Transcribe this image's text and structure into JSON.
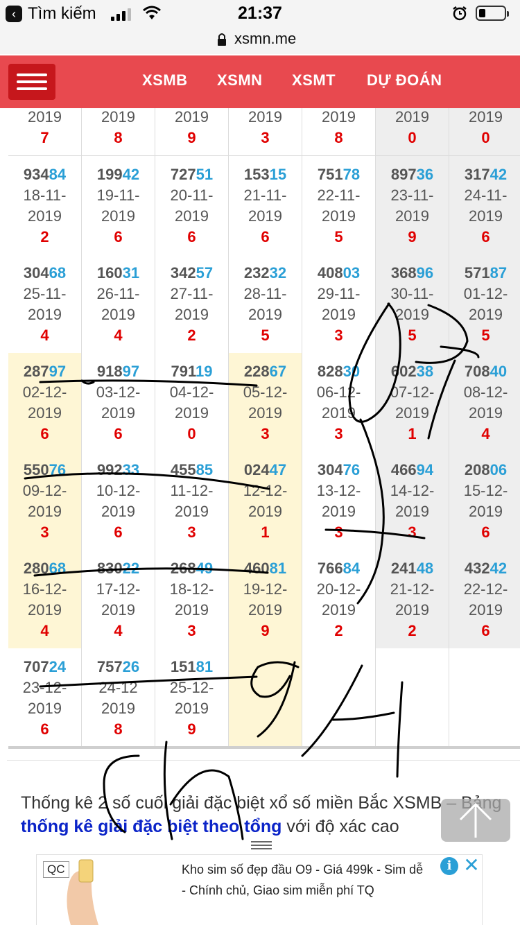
{
  "status_bar": {
    "back_label": "Tìm kiếm",
    "time": "21:37",
    "url": "xsmn.me"
  },
  "nav": {
    "items": [
      "XSMB",
      "XSMN",
      "XSMT",
      "DỰ ĐOÁN"
    ]
  },
  "table": {
    "top_partial_row": {
      "years": [
        "2019",
        "2019",
        "2019",
        "2019",
        "2019",
        "2019",
        "2019"
      ],
      "totals": [
        "7",
        "8",
        "9",
        "3",
        "8",
        "0",
        "0"
      ]
    },
    "rows": [
      [
        {
          "head": "934",
          "tail": "84",
          "date": "18-11-",
          "year": "2019",
          "total": "2"
        },
        {
          "head": "199",
          "tail": "42",
          "date": "19-11-",
          "year": "2019",
          "total": "6"
        },
        {
          "head": "727",
          "tail": "51",
          "date": "20-11-",
          "year": "2019",
          "total": "6"
        },
        {
          "head": "153",
          "tail": "15",
          "date": "21-11-",
          "year": "2019",
          "total": "6"
        },
        {
          "head": "751",
          "tail": "78",
          "date": "22-11-",
          "year": "2019",
          "total": "5"
        },
        {
          "head": "897",
          "tail": "36",
          "date": "23-11-",
          "year": "2019",
          "total": "9"
        },
        {
          "head": "317",
          "tail": "42",
          "date": "24-11-",
          "year": "2019",
          "total": "6"
        }
      ],
      [
        {
          "head": "304",
          "tail": "68",
          "date": "25-11-",
          "year": "2019",
          "total": "4"
        },
        {
          "head": "160",
          "tail": "31",
          "date": "26-11-",
          "year": "2019",
          "total": "4"
        },
        {
          "head": "342",
          "tail": "57",
          "date": "27-11-",
          "year": "2019",
          "total": "2"
        },
        {
          "head": "232",
          "tail": "32",
          "date": "28-11-",
          "year": "2019",
          "total": "5"
        },
        {
          "head": "408",
          "tail": "03",
          "date": "29-11-",
          "year": "2019",
          "total": "3"
        },
        {
          "head": "368",
          "tail": "96",
          "date": "30-11-",
          "year": "2019",
          "total": "5"
        },
        {
          "head": "571",
          "tail": "87",
          "date": "01-12-",
          "year": "2019",
          "total": "5"
        }
      ],
      [
        {
          "head": "287",
          "tail": "97",
          "date": "02-12-",
          "year": "2019",
          "total": "6"
        },
        {
          "head": "918",
          "tail": "97",
          "date": "03-12-",
          "year": "2019",
          "total": "6"
        },
        {
          "head": "791",
          "tail": "19",
          "date": "04-12-",
          "year": "2019",
          "total": "0"
        },
        {
          "head": "228",
          "tail": "67",
          "date": "05-12-",
          "year": "2019",
          "total": "3"
        },
        {
          "head": "828",
          "tail": "30",
          "date": "06-12-",
          "year": "2019",
          "total": "3"
        },
        {
          "head": "602",
          "tail": "38",
          "date": "07-12-",
          "year": "2019",
          "total": "1"
        },
        {
          "head": "708",
          "tail": "40",
          "date": "08-12-",
          "year": "2019",
          "total": "4"
        }
      ],
      [
        {
          "head": "550",
          "tail": "76",
          "date": "09-12-",
          "year": "2019",
          "total": "3"
        },
        {
          "head": "992",
          "tail": "33",
          "date": "10-12-",
          "year": "2019",
          "total": "6"
        },
        {
          "head": "455",
          "tail": "85",
          "date": "11-12-",
          "year": "2019",
          "total": "3"
        },
        {
          "head": "024",
          "tail": "47",
          "date": "12-12-",
          "year": "2019",
          "total": "1"
        },
        {
          "head": "304",
          "tail": "76",
          "date": "13-12-",
          "year": "2019",
          "total": "3"
        },
        {
          "head": "466",
          "tail": "94",
          "date": "14-12-",
          "year": "2019",
          "total": "3"
        },
        {
          "head": "208",
          "tail": "06",
          "date": "15-12-",
          "year": "2019",
          "total": "6"
        }
      ],
      [
        {
          "head": "280",
          "tail": "68",
          "date": "16-12-",
          "year": "2019",
          "total": "4"
        },
        {
          "head": "830",
          "tail": "22",
          "date": "17-12-",
          "year": "2019",
          "total": "4"
        },
        {
          "head": "268",
          "tail": "49",
          "date": "18-12-",
          "year": "2019",
          "total": "3"
        },
        {
          "head": "460",
          "tail": "81",
          "date": "19-12-",
          "year": "2019",
          "total": "9"
        },
        {
          "head": "766",
          "tail": "84",
          "date": "20-12-",
          "year": "2019",
          "total": "2"
        },
        {
          "head": "241",
          "tail": "48",
          "date": "21-12-",
          "year": "2019",
          "total": "2"
        },
        {
          "head": "432",
          "tail": "42",
          "date": "22-12-",
          "year": "2019",
          "total": "6"
        }
      ],
      [
        {
          "head": "707",
          "tail": "24",
          "date": "23-12-",
          "year": "2019",
          "total": "6"
        },
        {
          "head": "757",
          "tail": "26",
          "date": "24-12",
          "year": "2019",
          "total": "8"
        },
        {
          "head": "151",
          "tail": "81",
          "date": "25-12-",
          "year": "2019",
          "total": "9"
        },
        {
          "head": "",
          "tail": "",
          "date": "",
          "year": "",
          "total": ""
        },
        {
          "head": "",
          "tail": "",
          "date": "",
          "year": "",
          "total": ""
        },
        {
          "head": "",
          "tail": "",
          "date": "",
          "year": "",
          "total": ""
        },
        {
          "head": "",
          "tail": "",
          "date": "",
          "year": "",
          "total": ""
        }
      ]
    ]
  },
  "info": {
    "text_1": "Thống kê 2 số cuối giải đặc biệt xổ số miền Bắc XSMB – Bảng ",
    "link": "thống kê giải đặc biệt theo tổng",
    "text_2": " với độ xác cao"
  },
  "ad": {
    "badge": "QC",
    "line1": "Kho sim số đẹp đầu O9 - Giá 499k - Sim dễ",
    "line2": "- Chính chủ, Giao sim miễn phí TQ",
    "info_glyph": "i",
    "close_glyph": "✕"
  },
  "colors": {
    "nav_red": "#e8494f",
    "menu_red": "#c6171c",
    "number_blue": "#2a9fd6",
    "total_red": "#e00000",
    "highlight_yellow": "#fef6d5",
    "weekend_grey": "#eeeeee",
    "link_blue": "#0b24c8"
  },
  "icons": [
    "back-arrow-icon",
    "signal-icon",
    "wifi-icon",
    "alarm-icon",
    "battery-icon",
    "lock-icon",
    "hamburger-menu-icon",
    "scroll-top-arrow-icon",
    "drag-handle-icon",
    "ad-info-icon",
    "ad-close-icon"
  ]
}
